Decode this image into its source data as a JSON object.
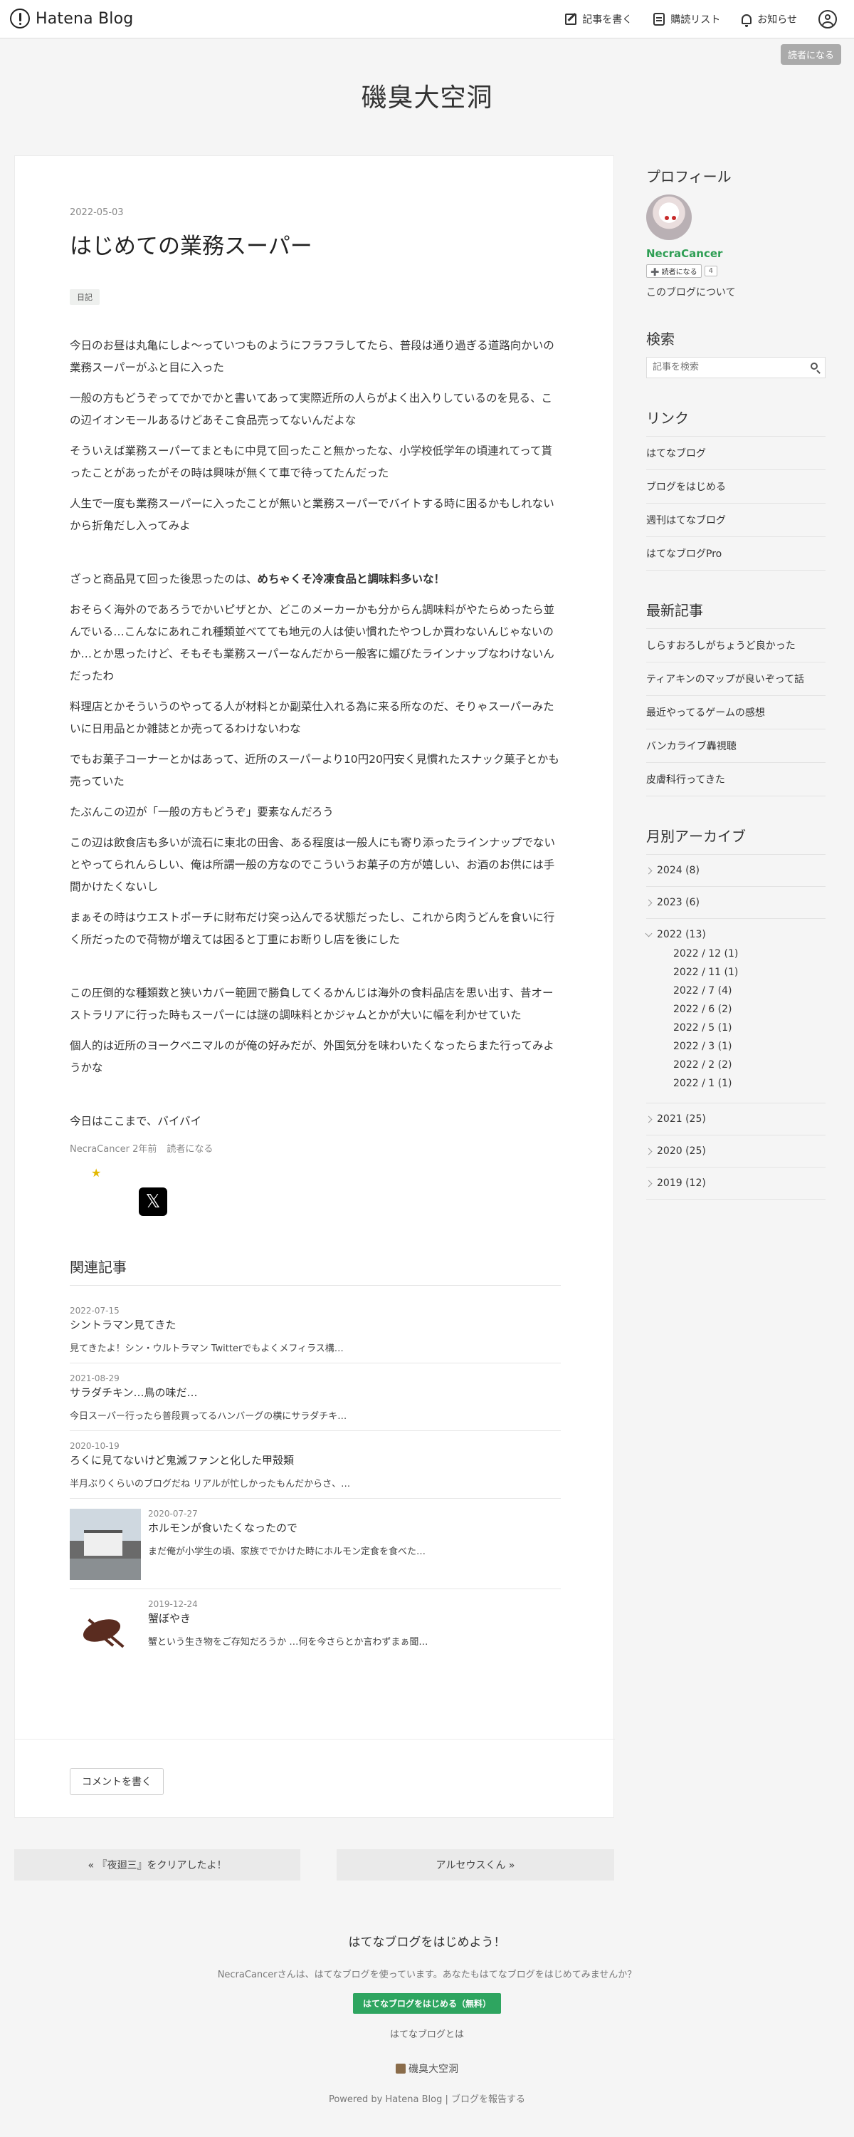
{
  "header": {
    "logo_text": "Hatena Blog",
    "nav": {
      "write": "記事を書く",
      "reading_list": "購読リスト",
      "notifications": "お知らせ"
    }
  },
  "subscribe_label": "読者になる",
  "blog_title": "磯臭大空洞",
  "article": {
    "date": "2022-05-03",
    "title": "はじめての業務スーパー",
    "category": "日記",
    "paragraphs": {
      "p1": "今日のお昼は丸亀にしよ〜っていつものようにフラフラしてたら、普段は通り過ぎる道路向かいの業務スーパーがふと目に入った",
      "p2": "一般の方もどうぞってでかでかと書いてあって実際近所の人らがよく出入りしているのを見る、この辺イオンモールあるけどあそこ食品売ってないんだよな",
      "p3": "そういえば業務スーパーてまともに中見て回ったこと無かったな、小学校低学年の頃連れてって貰ったことがあったがその時は興味が無くて車で待ってたんだった",
      "p4": "人生で一度も業務スーパーに入ったことが無いと業務スーパーでバイトする時に困るかもしれないから折角だし入ってみよ",
      "p5_pre": "ざっと商品見て回った後思ったのは、",
      "p5_bold": "めちゃくそ冷凍食品と調味料多いな！",
      "p6": "おそらく海外のであろうでかいピザとか、どこのメーカーかも分からん調味料がやたらめったら並んでいる…こんなにあれこれ種類並べてても地元の人は使い慣れたやつしか買わないんじゃないのか…とか思ったけど、そもそも業務スーパーなんだから一般客に媚びたラインナップなわけないんだったわ",
      "p7": "料理店とかそういうのやってる人が材料とか副菜仕入れる為に来る所なのだ、そりゃスーパーみたいに日用品とか雑誌とか売ってるわけないわな",
      "p8": "でもお菓子コーナーとかはあって、近所のスーパーより10円20円安く見慣れたスナック菓子とかも売っていた",
      "p9": "たぶんこの辺が「一般の方もどうぞ」要素なんだろう",
      "p10": "この辺は飲食店も多いが流石に東北の田舎、ある程度は一般人にも寄り添ったラインナップでないとやってられんらしい、俺は所謂一般の方なのでこういうお菓子の方が嬉しい、お酒のお供には手間かけたくないし",
      "p11": "まぁその時はウエストポーチに財布だけ突っ込んでる状態だったし、これから肉うどんを食いに行く所だったので荷物が増えては困ると丁重にお断りし店を後にした",
      "p12": "この圧倒的な種類数と狭いカバー範囲で勝負してくるかんじは海外の食料品店を思い出す、昔オーストラリアに行った時もスーパーには謎の調味料とかジャムとかが大いに幅を利かせていた",
      "p13": "個人的は近所のヨークベニマルのが俺の好みだが、外国気分を味わいたくなったらまた行ってみようかな",
      "p14": "今日はここまで、バイバイ"
    },
    "footer_author": "NecraCancer",
    "footer_time": "2年前",
    "footer_subscribe": "読者になる"
  },
  "related": {
    "heading": "関連記事",
    "items": [
      {
        "date": "2022-07-15",
        "title": "シントラマン見てきた",
        "desc": "見てきたよ！シン・ウルトラマン Twitterでもよくメフィラス構…"
      },
      {
        "date": "2021-08-29",
        "title": "サラダチキン…鳥の味だ…",
        "desc": "今日スーパー行ったら普段買ってるハンバーグの横にサラダチキ…"
      },
      {
        "date": "2020-10-19",
        "title": "ろくに見てないけど鬼滅ファンと化した甲殻類",
        "desc": "半月ぶりくらいのブログだね リアルが忙しかったもんだからさ、…"
      },
      {
        "date": "2020-07-27",
        "title": "ホルモンが食いたくなったので",
        "desc": "まだ俺が小学生の頃、家族ででかけた時にホルモン定食を食べた…"
      },
      {
        "date": "2019-12-24",
        "title": "蟹ぼやき",
        "desc": "蟹という生き物をご存知だろうか …何を今さらとか言わずまぁ聞…"
      }
    ]
  },
  "comment_button": "コメントを書く",
  "pager": {
    "prev": "« 『夜廻三』をクリアしたよ！",
    "next": "アルセウスくん »"
  },
  "sidebar": {
    "profile": {
      "title": "プロフィール",
      "name": "NecraCancer",
      "subscribe": "➕ 読者になる",
      "count": "4",
      "about": "このブログについて"
    },
    "search": {
      "title": "検索",
      "placeholder": "記事を検索"
    },
    "links": {
      "title": "リンク",
      "items": [
        "はてなブログ",
        "ブログをはじめる",
        "週刊はてなブログ",
        "はてなブログPro"
      ]
    },
    "recent": {
      "title": "最新記事",
      "items": [
        "しらすおろしがちょうど良かった",
        "ティアキンのマップが良いぞって話",
        "最近やってるゲームの感想",
        "バンカライブ轟視聴",
        "皮膚科行ってきた"
      ]
    },
    "archive": {
      "title": "月別アーカイブ",
      "years": {
        "y2024": "2024 (8)",
        "y2023": "2023 (6)",
        "y2022": "2022 (13)",
        "y2021": "2021 (25)",
        "y2020": "2020 (25)",
        "y2019": "2019 (12)"
      },
      "months": [
        "2022 / 12 (1)",
        "2022 / 11 (1)",
        "2022 / 7 (4)",
        "2022 / 6 (2)",
        "2022 / 5 (1)",
        "2022 / 3 (1)",
        "2022 / 2 (2)",
        "2022 / 1 (1)"
      ]
    }
  },
  "footer": {
    "title": "はてなブログをはじめよう！",
    "text": "NecraCancerさんは、はてなブログを使っています。あなたもはてなブログをはじめてみませんか？",
    "start_button": "はてなブログをはじめる（無料）",
    "about_link": "はてなブログとは",
    "blog_name": "磯臭大空洞",
    "powered_by": "Powered by Hatena Blog",
    "report": "ブログを報告する"
  }
}
